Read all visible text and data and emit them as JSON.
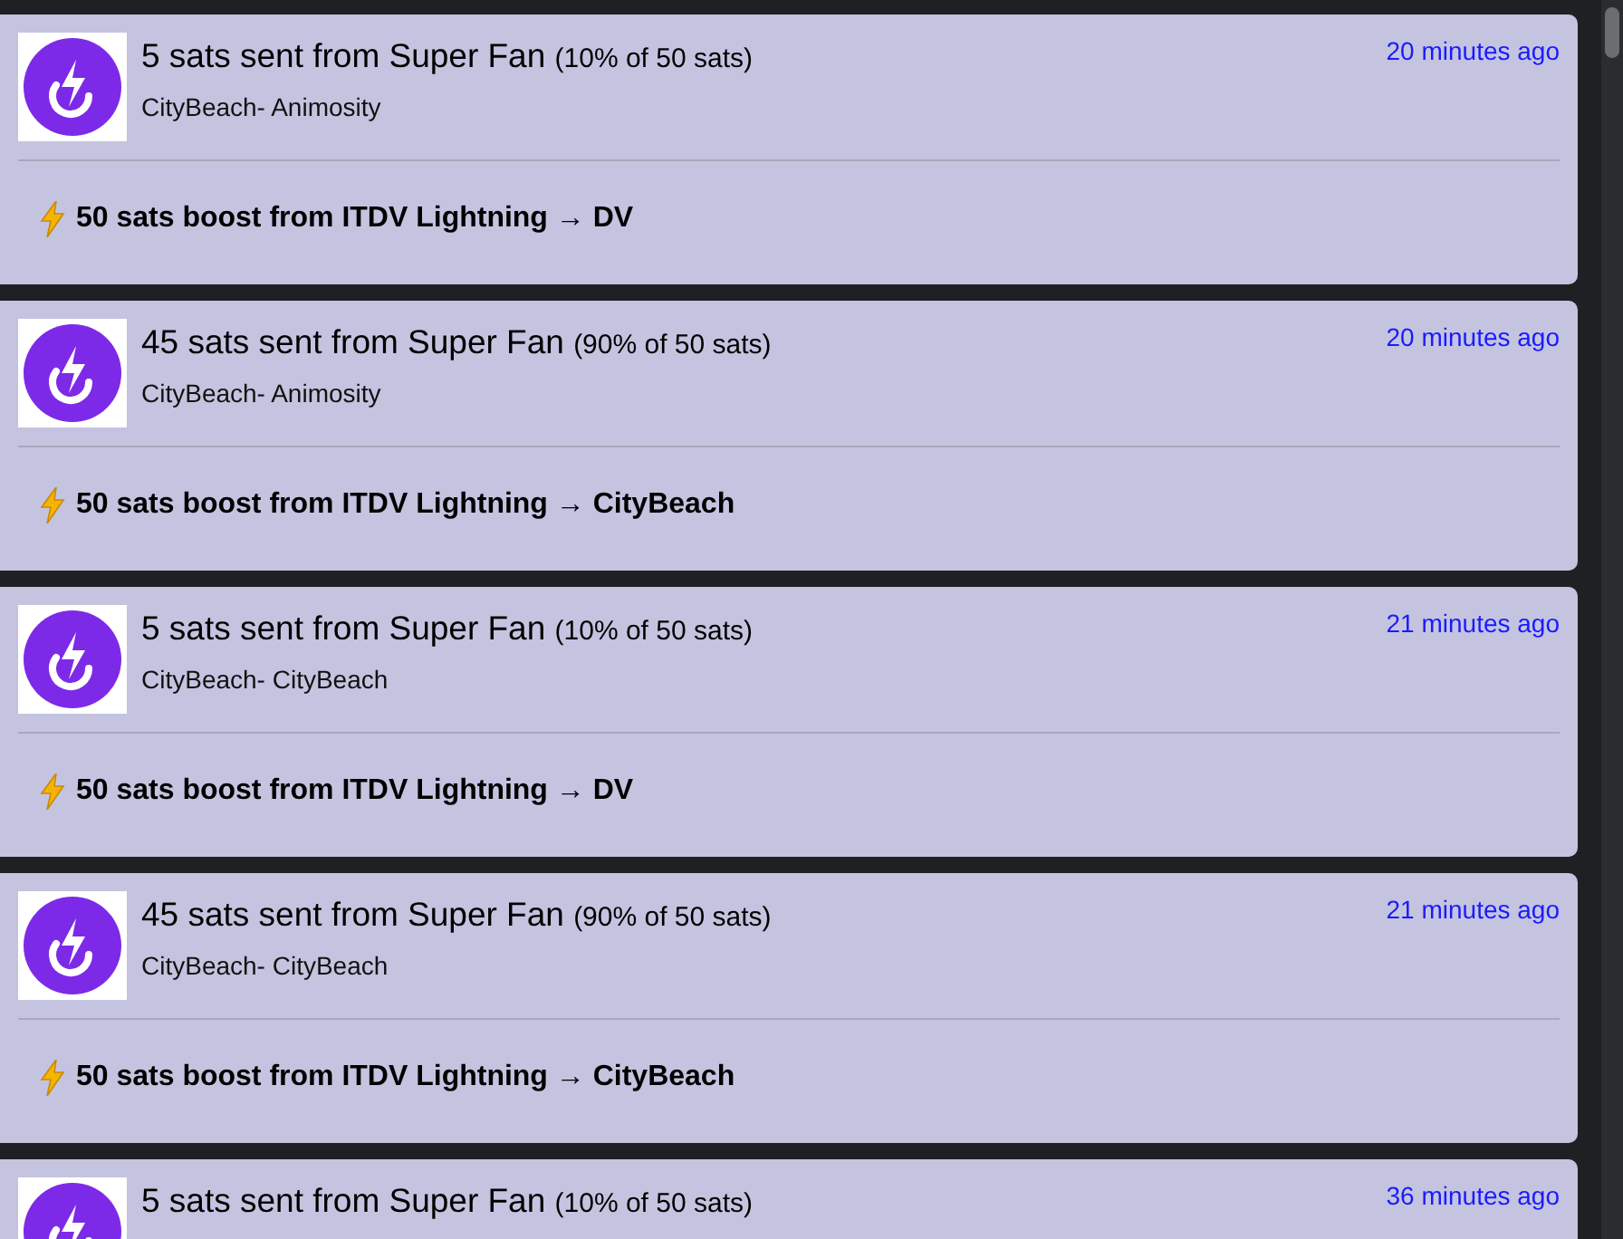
{
  "notifications": [
    {
      "title": "5 sats sent from Super Fan",
      "share": "(10% of 50 sats)",
      "source": "CityBeach- Animosity",
      "time": "20 minutes ago",
      "boost": "50 sats boost from ITDV Lightning → DV"
    },
    {
      "title": "45 sats sent from Super Fan",
      "share": "(90% of 50 sats)",
      "source": "CityBeach- Animosity",
      "time": "20 minutes ago",
      "boost": "50 sats boost from ITDV Lightning → CityBeach"
    },
    {
      "title": "5 sats sent from Super Fan",
      "share": "(10% of 50 sats)",
      "source": "CityBeach- CityBeach",
      "time": "21 minutes ago",
      "boost": "50 sats boost from ITDV Lightning → DV"
    },
    {
      "title": "45 sats sent from Super Fan",
      "share": "(90% of 50 sats)",
      "source": "CityBeach- CityBeach",
      "time": "21 minutes ago",
      "boost": "50 sats boost from ITDV Lightning → CityBeach"
    },
    {
      "title": "5 sats sent from Super Fan",
      "share": "(10% of 50 sats)",
      "time": "36 minutes ago"
    }
  ]
}
